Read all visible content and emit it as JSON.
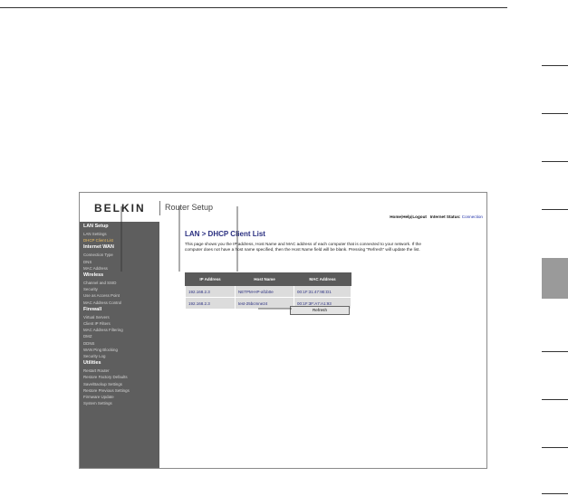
{
  "header": {
    "logo": "BELKIN",
    "product": "Router Setup",
    "links": [
      "Home",
      "Help",
      "Logout"
    ],
    "status_label": "Internet Status:",
    "status_value": "Connection"
  },
  "sidebar": {
    "sections": [
      {
        "title": "LAN Setup",
        "items": [
          "LAN Settings",
          "DHCP Client List"
        ]
      },
      {
        "title": "Internet WAN",
        "items": [
          "Connection Type",
          "DNS",
          "MAC Address"
        ]
      },
      {
        "title": "Wireless",
        "items": [
          "Channel and SSID",
          "Security",
          "Use as Access Point",
          "MAC Address Control"
        ]
      },
      {
        "title": "Firewall",
        "items": [
          "Virtual Servers",
          "Client IP Filters",
          "MAC Address Filtering",
          "DMZ",
          "DDNS",
          "WAN Ping Blocking",
          "Security Log"
        ]
      },
      {
        "title": "Utilities",
        "items": [
          "Restart Router",
          "Restore Factory Defaults",
          "Save/Backup Settings",
          "Restore Previous Settings",
          "Firmware Update",
          "System Settings"
        ]
      }
    ]
  },
  "main": {
    "title": "LAN > DHCP Client List",
    "intro": "This page shows you the IP address, Host Name and MAC address of each computer that is connected to your network. If the computer does not have a host name specified, then the Host Name field will be blank. Pressing \"Refresh\" will update the list.",
    "table": {
      "headers": [
        "IP Address",
        "Host Name",
        "MAC Address"
      ],
      "rows": [
        [
          "192.168.2.3",
          "NETPM-HP-af1b0e",
          "00:1F:31:47:9E:D1"
        ],
        [
          "192.168.2.3",
          "test-25bcmne24",
          "00:1F:3F:A7:A1:93"
        ]
      ]
    },
    "refresh_label": "Refresh"
  },
  "colors": {
    "sidebar_bg": "#5e5e5e",
    "title_blue": "#2a2f80",
    "active_item": "#f0c060",
    "table_header": "#5a5a5a",
    "row_bg": "#dcdcdc"
  }
}
